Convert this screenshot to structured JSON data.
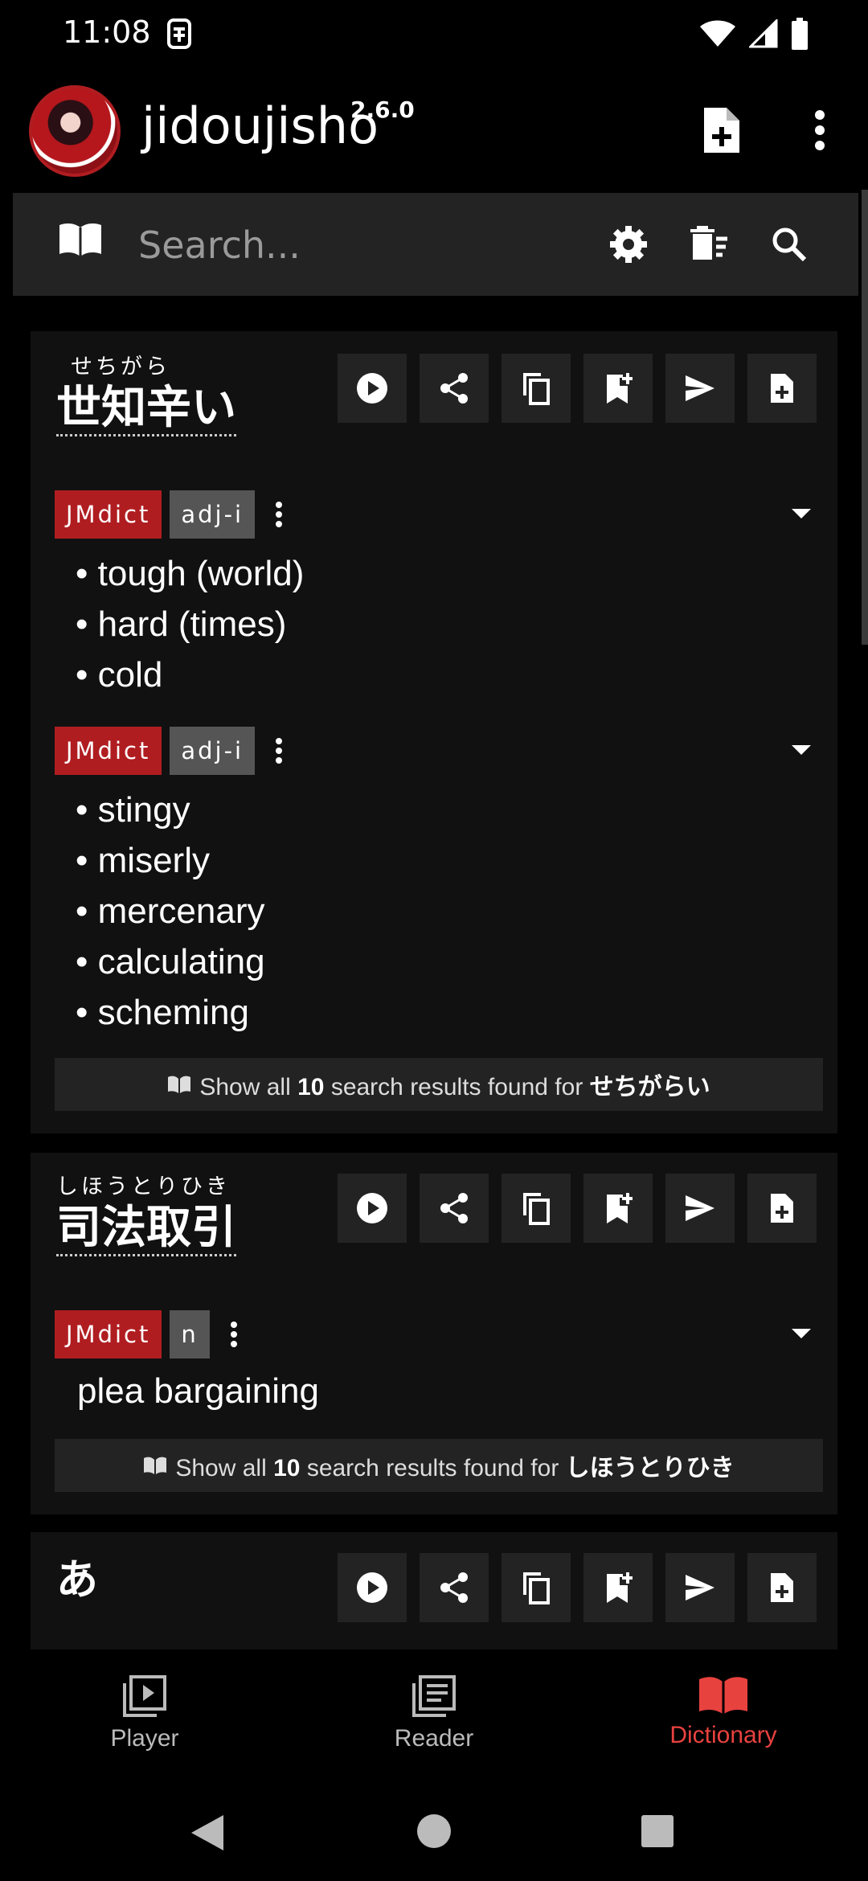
{
  "status_bar": {
    "time": "11:08"
  },
  "app_bar": {
    "title": "jidoujisho",
    "version": "2.6.0"
  },
  "search": {
    "placeholder": "Search..."
  },
  "entries": [
    {
      "reading": "せちがら",
      "headword": "世知辛い",
      "senses": [
        {
          "dictionary": "JMdict",
          "pos": "adj-i",
          "glosses": [
            "tough (world)",
            "hard (times)",
            "cold"
          ]
        },
        {
          "dictionary": "JMdict",
          "pos": "adj-i",
          "glosses": [
            "stingy",
            "miserly",
            "mercenary",
            "calculating",
            "scheming"
          ]
        }
      ],
      "show_all": {
        "prefix": "Show all",
        "count": "10",
        "middle": "search results found for",
        "term": "せちがらい"
      }
    },
    {
      "reading": "しほうとりひき",
      "headword": "司法取引",
      "senses": [
        {
          "dictionary": "JMdict",
          "pos": "n",
          "glosses": [
            "plea bargaining"
          ]
        }
      ],
      "show_all": {
        "prefix": "Show all",
        "count": "10",
        "middle": "search results found for",
        "term": "しほうとりひき"
      }
    },
    {
      "reading": "",
      "headword": "あ"
    }
  ],
  "bottom_nav": [
    {
      "label": "Player",
      "icon": "player-icon",
      "active": false
    },
    {
      "label": "Reader",
      "icon": "reader-icon",
      "active": false
    },
    {
      "label": "Dictionary",
      "icon": "dictionary-icon",
      "active": true
    }
  ],
  "colors": {
    "accent": "#e8423f",
    "dictionary_tag": "#b01d21",
    "pos_tag": "#555555",
    "card_bg": "#111111",
    "button_bg": "#232323"
  }
}
